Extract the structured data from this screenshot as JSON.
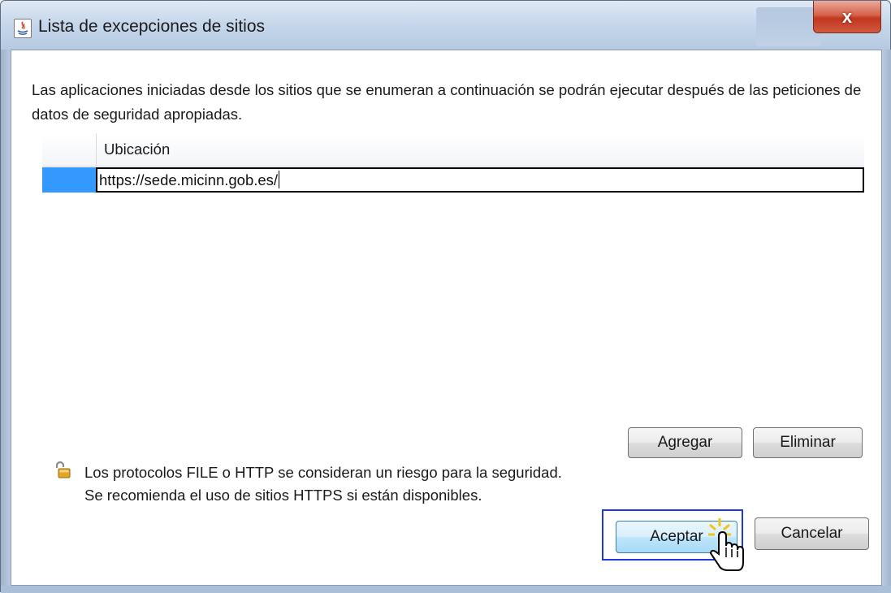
{
  "window": {
    "title": "Lista de excepciones de sitios",
    "close_label": "x"
  },
  "dialog": {
    "description": "Las aplicaciones iniciadas desde los sitios que se enumeran a continuación se podrán ejecutar después de las peticiones de datos de seguridad apropiadas."
  },
  "table": {
    "columns": [
      "",
      "Ubicación"
    ],
    "rows": [
      {
        "location": "https://sede.micinn.gob.es/"
      }
    ]
  },
  "buttons": {
    "add_label": "Agregar",
    "remove_label": "Eliminar",
    "accept_label": "Aceptar",
    "cancel_label": "Cancelar"
  },
  "info": {
    "line1": "Los protocolos FILE o HTTP se consideran un riesgo para la seguridad.",
    "line2": "Se recomienda el uso de sitios HTTPS si están disponibles."
  },
  "colors": {
    "selection": "#3399ff",
    "highlight_frame": "#1f38d8",
    "close_button": "#c2371f"
  },
  "icons": {
    "app": "java-icon",
    "info": "unlocked-padlock-icon",
    "cursor": "hand-pointer-icon"
  }
}
